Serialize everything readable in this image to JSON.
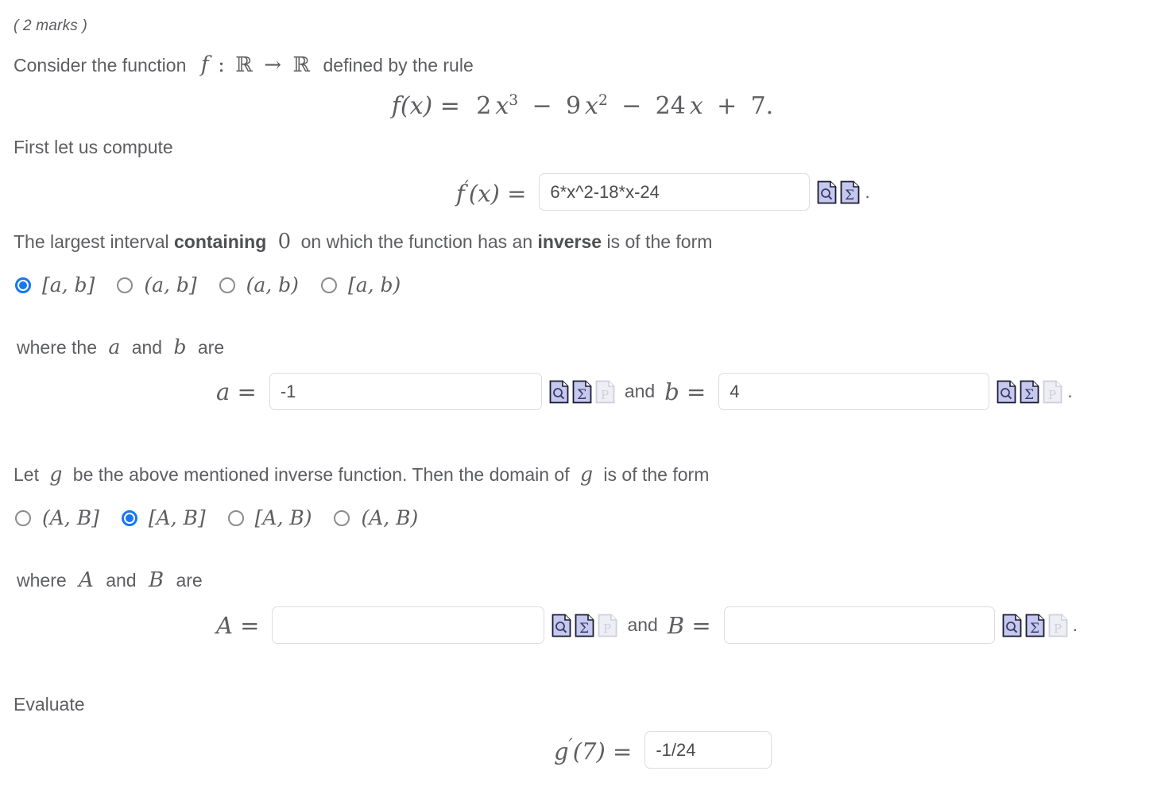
{
  "marks": "( 2 marks )",
  "intro": {
    "prefix": "Consider the function",
    "function_symbol": "f",
    "colon": ":",
    "domain": "ℝ",
    "arrow": "→",
    "codomain": "ℝ",
    "suffix": "defined by the rule"
  },
  "formula": {
    "lhs": "f(x) =",
    "term1_coef": "2",
    "term1_var": "x",
    "term1_pow": "3",
    "op1": "−",
    "term2_coef": "9",
    "term2_var": "x",
    "term2_pow": "2",
    "op2": "−",
    "term3_coef": "24",
    "term3_var": "x",
    "op3": "+",
    "term4": "7",
    "end": "."
  },
  "compute_line": "First let us compute",
  "derivative_row": {
    "label_f": "f",
    "label_prime": "′",
    "label_arg": "(x) =",
    "value": "6*x^2-18*x-24",
    "placeholder": "",
    "icons": [
      "preview-icon",
      "sigma-icon"
    ],
    "trailing": "."
  },
  "interval_question": {
    "part1": "The largest interval",
    "bold1": "containing",
    "zero": "0",
    "part2": "on which the function has an",
    "bold2": "inverse",
    "part3": "is of the form"
  },
  "interval_options": [
    {
      "label": "[a, b]",
      "selected": true
    },
    {
      "label": "(a, b]",
      "selected": false
    },
    {
      "label": "(a, b)",
      "selected": false
    },
    {
      "label": "[a, b)",
      "selected": false
    }
  ],
  "ab_intro": {
    "text1": "where the",
    "var_a": "a",
    "and": "and",
    "var_b": "b",
    "text2": "are"
  },
  "ab_row": {
    "a_label": "a =",
    "a_value": "-1",
    "a_placeholder": "",
    "conj": "and",
    "b_label": "b =",
    "b_value": "4",
    "b_placeholder": "",
    "icons": [
      "preview-icon",
      "sigma-icon",
      "plot-icon"
    ],
    "trailing": "."
  },
  "domain_question": {
    "part1": "Let",
    "var_g": "g",
    "part2": "be the above mentioned inverse function. Then the domain of",
    "var_g2": "g",
    "part3": "is of the form"
  },
  "domain_options": [
    {
      "label": "(A, B]",
      "selected": false
    },
    {
      "label": "[A, B]",
      "selected": true
    },
    {
      "label": "[A, B)",
      "selected": false
    },
    {
      "label": "(A, B)",
      "selected": false
    }
  ],
  "AB_intro": {
    "text1": "where",
    "var_A": "A",
    "and": "and",
    "var_B": "B",
    "text2": "are"
  },
  "AB_row": {
    "A_label": "A =",
    "A_value": "",
    "A_placeholder": "",
    "conj": "and",
    "B_label": "B =",
    "B_value": "",
    "B_placeholder": "",
    "icons": [
      "preview-icon",
      "sigma-icon",
      "plot-icon"
    ],
    "trailing": "."
  },
  "evaluate_line": "Evaluate",
  "evaluate_row": {
    "label_g": "g",
    "label_prime": "′",
    "label_arg": "(7) =",
    "value": "-1/24",
    "placeholder": ""
  },
  "colors": {
    "accent": "#1778f2",
    "text": "#5d5e61",
    "icon_fill": "#c5c8ef",
    "icon_fill_disabled": "#e6e6ee",
    "border": "#dcdcdc"
  }
}
